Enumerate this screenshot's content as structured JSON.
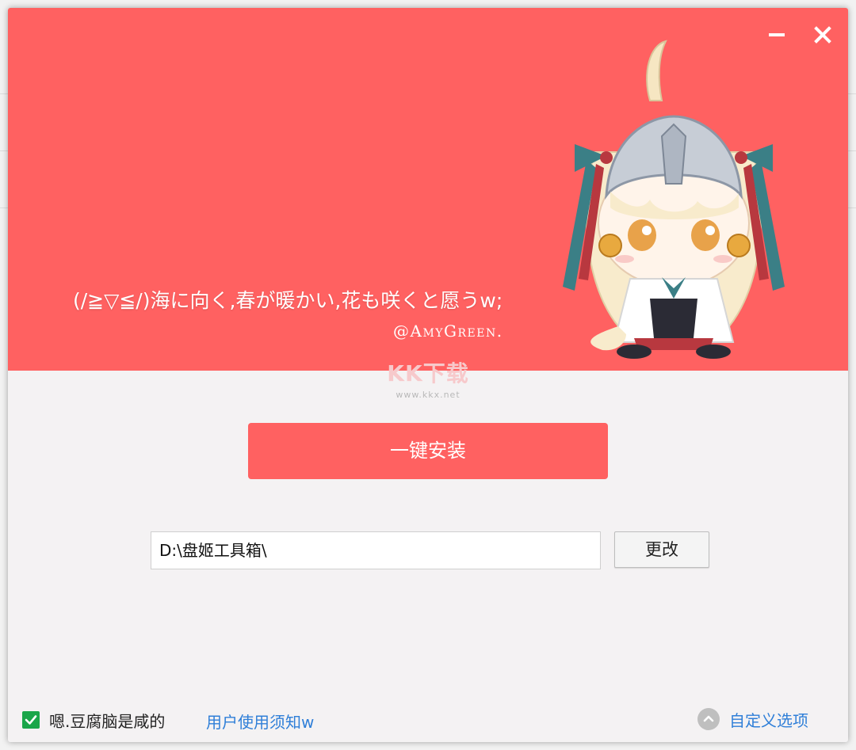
{
  "banner": {
    "quote": "(/≧▽≦/)海に向く,春が暖かい,花も咲くと愿うw;",
    "signature": "@AmyGreen.",
    "color": "#ff6161"
  },
  "window_controls": {
    "minimize_icon": "minimize-icon",
    "close_icon": "close-icon"
  },
  "watermark": {
    "logo": "KK下载",
    "url": "www.kkx.net"
  },
  "install": {
    "button_label": "一键安装"
  },
  "path": {
    "value": "D:\\盘姬工具箱\\",
    "change_label": "更改"
  },
  "footer": {
    "agree_checked": true,
    "agree_label": "嗯.豆腐脑是咸的",
    "terms_link": "用户使用须知w",
    "custom_options_label": "自定义选项"
  },
  "colors": {
    "accent": "#ff6161",
    "link": "#2f7fd8",
    "checkbox": "#1aa64a"
  }
}
